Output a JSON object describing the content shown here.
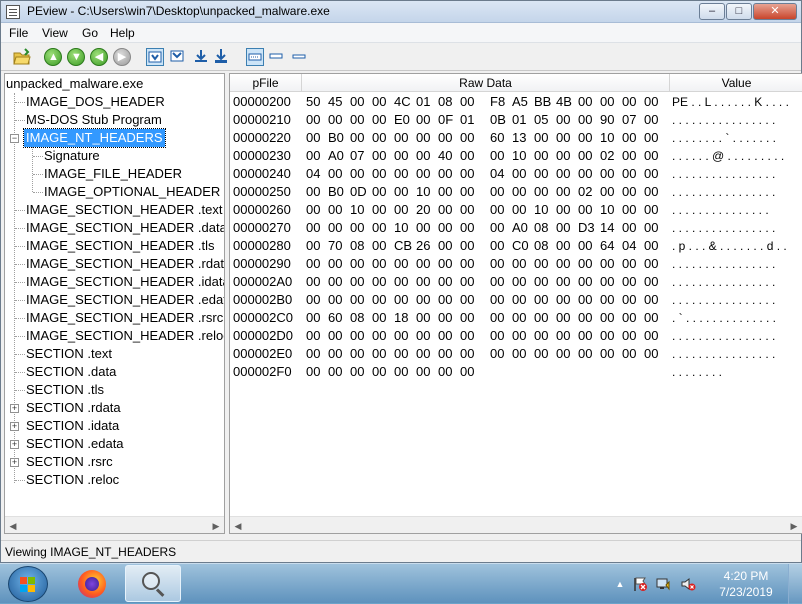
{
  "window": {
    "title": "PEview - C:\\Users\\win7\\Desktop\\unpacked_malware.exe",
    "minimize_label": "–",
    "maximize_label": "□",
    "close_label": "✕"
  },
  "menu": {
    "items": [
      {
        "label": "File"
      },
      {
        "label": "View"
      },
      {
        "label": "Go"
      },
      {
        "label": "Help"
      }
    ]
  },
  "toolbar": {
    "icons": [
      "open-folder-icon",
      "go-first-icon",
      "go-down-icon",
      "go-back-icon",
      "go-forward-icon",
      "view-byte-icon",
      "view-word-icon",
      "view-dword-icon",
      "view-qword-icon",
      "view-hex-icon",
      "view-hex-small-icon",
      "view-hex-tiny-icon"
    ]
  },
  "tree": {
    "root": "unpacked_malware.exe",
    "items": [
      {
        "label": "IMAGE_DOS_HEADER"
      },
      {
        "label": "MS-DOS Stub Program"
      },
      {
        "label": "IMAGE_NT_HEADERS",
        "expander": "−"
      },
      {
        "label": "Signature"
      },
      {
        "label": "IMAGE_FILE_HEADER"
      },
      {
        "label": "IMAGE_OPTIONAL_HEADER"
      },
      {
        "label": "IMAGE_SECTION_HEADER .text"
      },
      {
        "label": "IMAGE_SECTION_HEADER .data"
      },
      {
        "label": "IMAGE_SECTION_HEADER .tls"
      },
      {
        "label": "IMAGE_SECTION_HEADER .rdata"
      },
      {
        "label": "IMAGE_SECTION_HEADER .idata"
      },
      {
        "label": "IMAGE_SECTION_HEADER .edata"
      },
      {
        "label": "IMAGE_SECTION_HEADER .rsrc"
      },
      {
        "label": "IMAGE_SECTION_HEADER .reloc"
      },
      {
        "label": "SECTION .text"
      },
      {
        "label": "SECTION .data"
      },
      {
        "label": "SECTION .tls"
      },
      {
        "label": "SECTION .rdata",
        "expander": "+"
      },
      {
        "label": "SECTION .idata",
        "expander": "+"
      },
      {
        "label": "SECTION .edata",
        "expander": "+"
      },
      {
        "label": "SECTION .rsrc",
        "expander": "+"
      },
      {
        "label": "SECTION .reloc"
      }
    ],
    "selected_index": 2
  },
  "hexview": {
    "columns": {
      "pfile": "pFile",
      "raw": "Raw Data",
      "value": "Value"
    },
    "rows": [
      {
        "offset": "00000200",
        "bytes": [
          "50",
          "45",
          "00",
          "00",
          "4C",
          "01",
          "08",
          "00",
          "F8",
          "A5",
          "BB",
          "4B",
          "00",
          "00",
          "00",
          "00"
        ],
        "value": "PE . . L . . . . . . K . . . ."
      },
      {
        "offset": "00000210",
        "bytes": [
          "00",
          "00",
          "00",
          "00",
          "E0",
          "00",
          "0F",
          "01",
          "0B",
          "01",
          "05",
          "00",
          "00",
          "90",
          "07",
          "00"
        ],
        "value": ". . . . . . . . . . . . . . . ."
      },
      {
        "offset": "00000220",
        "bytes": [
          "00",
          "B0",
          "00",
          "00",
          "00",
          "00",
          "00",
          "00",
          "60",
          "13",
          "00",
          "00",
          "00",
          "10",
          "00",
          "00"
        ],
        "value": ". . . . . . . . ` . . . . . . ."
      },
      {
        "offset": "00000230",
        "bytes": [
          "00",
          "A0",
          "07",
          "00",
          "00",
          "00",
          "40",
          "00",
          "00",
          "10",
          "00",
          "00",
          "00",
          "02",
          "00",
          "00"
        ],
        "value": ". . . . . . @ . . . . . . . . ."
      },
      {
        "offset": "00000240",
        "bytes": [
          "04",
          "00",
          "00",
          "00",
          "00",
          "00",
          "00",
          "00",
          "04",
          "00",
          "00",
          "00",
          "00",
          "00",
          "00",
          "00"
        ],
        "value": ". . . . . . . . . . . . . . . ."
      },
      {
        "offset": "00000250",
        "bytes": [
          "00",
          "B0",
          "0D",
          "00",
          "00",
          "10",
          "00",
          "00",
          "00",
          "00",
          "00",
          "00",
          "02",
          "00",
          "00",
          "00"
        ],
        "value": ". . . . . . . . . . . . . . . ."
      },
      {
        "offset": "00000260",
        "bytes": [
          "00",
          "00",
          "10",
          "00",
          "00",
          "20",
          "00",
          "00",
          "00",
          "00",
          "10",
          "00",
          "00",
          "10",
          "00",
          "00"
        ],
        "value": ". . . . .   . . . . . . . . . ."
      },
      {
        "offset": "00000270",
        "bytes": [
          "00",
          "00",
          "00",
          "00",
          "10",
          "00",
          "00",
          "00",
          "00",
          "A0",
          "08",
          "00",
          "D3",
          "14",
          "00",
          "00"
        ],
        "value": ". . . . . . . . . . . . . . . ."
      },
      {
        "offset": "00000280",
        "bytes": [
          "00",
          "70",
          "08",
          "00",
          "CB",
          "26",
          "00",
          "00",
          "00",
          "C0",
          "08",
          "00",
          "00",
          "64",
          "04",
          "00"
        ],
        "value": ". p . . . & . . . . . . . d . ."
      },
      {
        "offset": "00000290",
        "bytes": [
          "00",
          "00",
          "00",
          "00",
          "00",
          "00",
          "00",
          "00",
          "00",
          "00",
          "00",
          "00",
          "00",
          "00",
          "00",
          "00"
        ],
        "value": ". . . . . . . . . . . . . . . ."
      },
      {
        "offset": "000002A0",
        "bytes": [
          "00",
          "00",
          "00",
          "00",
          "00",
          "00",
          "00",
          "00",
          "00",
          "00",
          "00",
          "00",
          "00",
          "00",
          "00",
          "00"
        ],
        "value": ". . . . . . . . . . . . . . . ."
      },
      {
        "offset": "000002B0",
        "bytes": [
          "00",
          "00",
          "00",
          "00",
          "00",
          "00",
          "00",
          "00",
          "00",
          "00",
          "00",
          "00",
          "00",
          "00",
          "00",
          "00"
        ],
        "value": ". . . . . . . . . . . . . . . ."
      },
      {
        "offset": "000002C0",
        "bytes": [
          "00",
          "60",
          "08",
          "00",
          "18",
          "00",
          "00",
          "00",
          "00",
          "00",
          "00",
          "00",
          "00",
          "00",
          "00",
          "00"
        ],
        "value": ". ` . . . . . . . . . . . . . ."
      },
      {
        "offset": "000002D0",
        "bytes": [
          "00",
          "00",
          "00",
          "00",
          "00",
          "00",
          "00",
          "00",
          "00",
          "00",
          "00",
          "00",
          "00",
          "00",
          "00",
          "00"
        ],
        "value": ". . . . . . . . . . . . . . . ."
      },
      {
        "offset": "000002E0",
        "bytes": [
          "00",
          "00",
          "00",
          "00",
          "00",
          "00",
          "00",
          "00",
          "00",
          "00",
          "00",
          "00",
          "00",
          "00",
          "00",
          "00"
        ],
        "value": ". . . . . . . . . . . . . . . ."
      },
      {
        "offset": "000002F0",
        "bytes": [
          "00",
          "00",
          "00",
          "00",
          "00",
          "00",
          "00",
          "00"
        ],
        "value": ". . . . . . . ."
      }
    ]
  },
  "status": {
    "text": "Viewing IMAGE_NT_HEADERS"
  },
  "taskbar": {
    "clock_time": "4:20 PM",
    "clock_date": "7/23/2019",
    "tray_up_label": "▲",
    "tray_icons": [
      "action-center-flag-icon",
      "network-icon",
      "volume-muted-icon"
    ]
  }
}
